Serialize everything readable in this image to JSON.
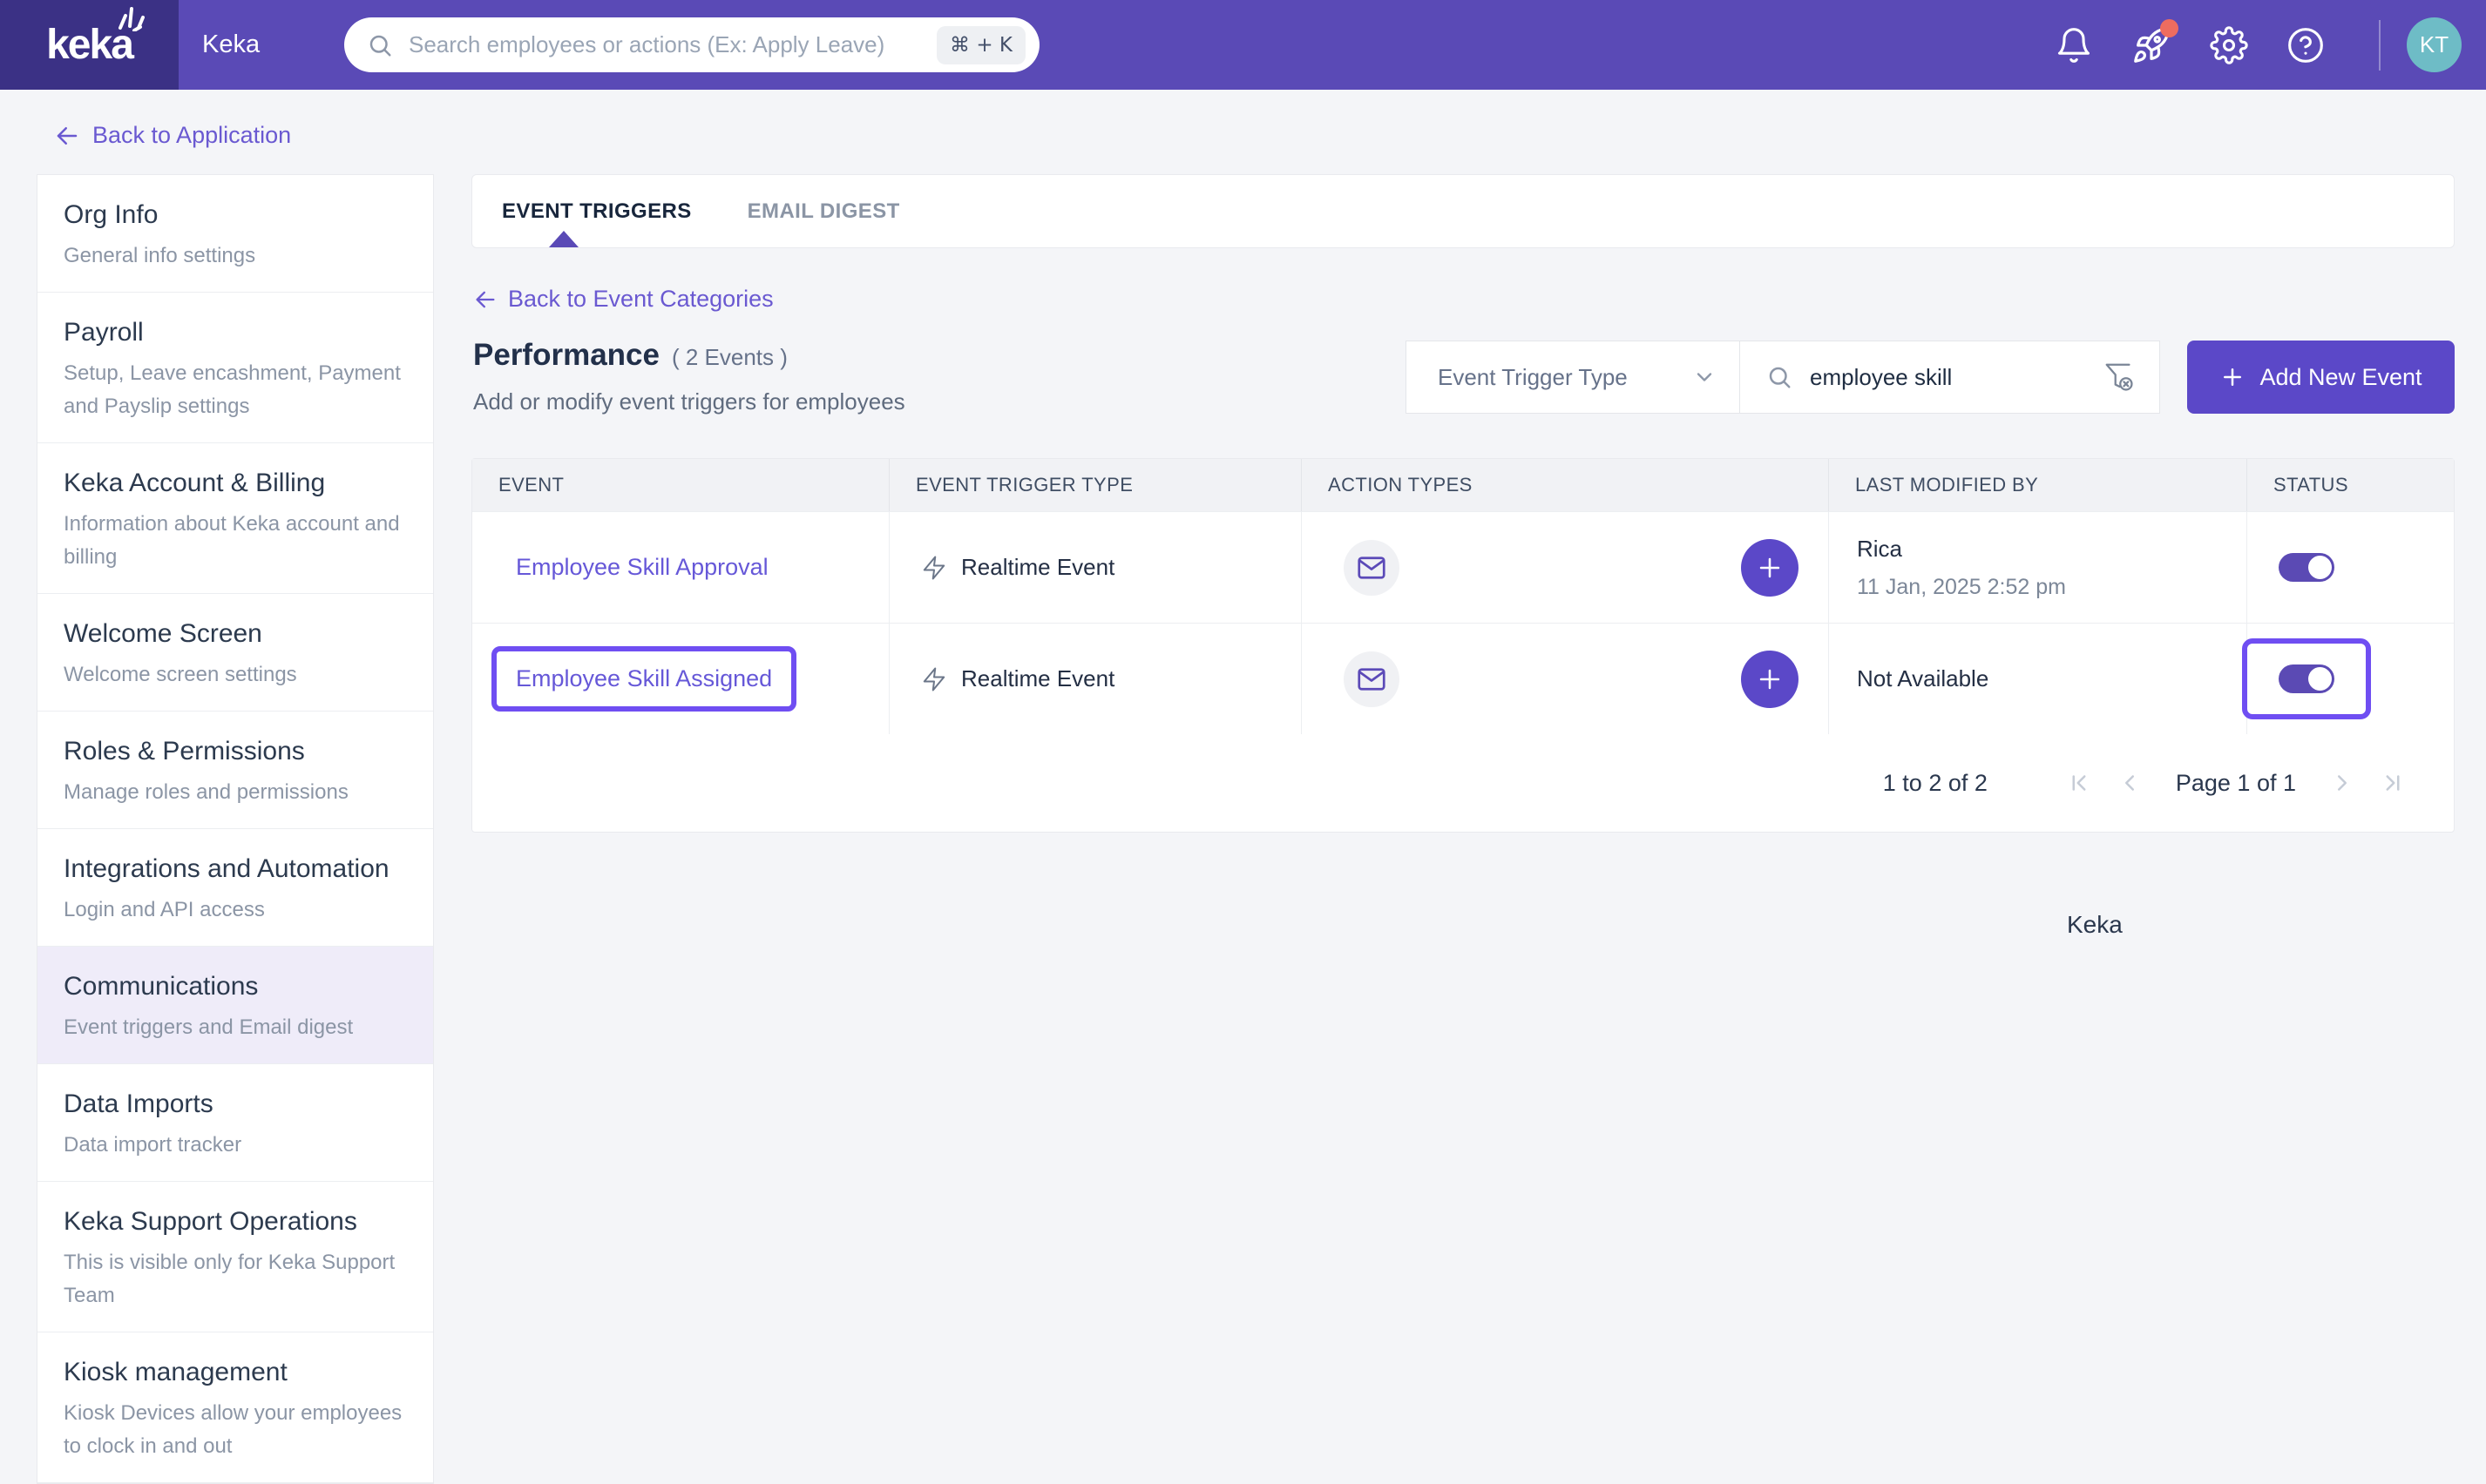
{
  "colors": {
    "topbar": "#5a4ab6",
    "logo_block": "#3b3185",
    "accent_link": "#6a59d1",
    "primary_button": "#5b48c8",
    "toggle_on": "#5b4ab4",
    "highlight_annotation": "#6f4ef2",
    "avatar_bg": "#6ebcc6",
    "notification_dot": "#ee6c5f",
    "selected_nav_bg": "#efecf9"
  },
  "topbar": {
    "logo_text": "keka",
    "app_name": "Keka",
    "search": {
      "placeholder": "Search employees or actions (Ex: Apply Leave)",
      "value": "",
      "shortcut": "⌘ + K"
    },
    "icons": [
      "bell-icon",
      "rocket-icon",
      "gear-icon",
      "help-icon"
    ],
    "avatar_initials": "KT"
  },
  "back_link": {
    "label": "Back to Application"
  },
  "sidebar": {
    "items": [
      {
        "title": "Org Info",
        "subtitle": "General info settings",
        "selected": false
      },
      {
        "title": "Payroll",
        "subtitle": "Setup, Leave encashment, Payment and Payslip settings",
        "selected": false
      },
      {
        "title": "Keka Account & Billing",
        "subtitle": "Information about Keka account and billing",
        "selected": false
      },
      {
        "title": "Welcome Screen",
        "subtitle": "Welcome screen settings",
        "selected": false
      },
      {
        "title": "Roles & Permissions",
        "subtitle": "Manage roles and permissions",
        "selected": false
      },
      {
        "title": "Integrations and Automation",
        "subtitle": "Login and API access",
        "selected": false
      },
      {
        "title": "Communications",
        "subtitle": "Event triggers and Email digest",
        "selected": true
      },
      {
        "title": "Data Imports",
        "subtitle": "Data import tracker",
        "selected": false
      },
      {
        "title": "Keka Support Operations",
        "subtitle": "This is visible only for Keka Support Team",
        "selected": false
      },
      {
        "title": "Kiosk management",
        "subtitle": "Kiosk Devices allow your employees to clock in and out",
        "selected": false
      }
    ]
  },
  "tabs": [
    {
      "label": "EVENT TRIGGERS",
      "active": true
    },
    {
      "label": "EMAIL DIGEST",
      "active": false
    }
  ],
  "content": {
    "back_link": "Back to Event Categories",
    "title": "Performance",
    "events_count": "( 2 Events )",
    "subtitle": "Add or modify event triggers for employees",
    "filter": {
      "dropdown_label": "Event Trigger Type",
      "search_value": "employee skill"
    },
    "add_button_label": "Add New Event"
  },
  "table": {
    "columns": [
      "EVENT",
      "EVENT TRIGGER TYPE",
      "ACTION TYPES",
      "LAST MODIFIED BY",
      "STATUS"
    ],
    "rows": [
      {
        "event": "Employee Skill Approval",
        "trigger_type": "Realtime Event",
        "action_types": [
          "email-action"
        ],
        "modified_by": "Rica",
        "modified_at": "11 Jan, 2025 2:52 pm",
        "status_on": true,
        "highlight_link": false,
        "highlight_status": false
      },
      {
        "event": "Employee Skill Assigned",
        "trigger_type": "Realtime Event",
        "action_types": [
          "email-action"
        ],
        "modified_by": "Not Available",
        "modified_at": "",
        "status_on": true,
        "highlight_link": true,
        "highlight_status": true
      }
    ],
    "pagination": {
      "range_label": "1 to 2 of 2",
      "page_label": "Page 1 of 1"
    }
  },
  "footer": {
    "brand_label": "Keka"
  }
}
